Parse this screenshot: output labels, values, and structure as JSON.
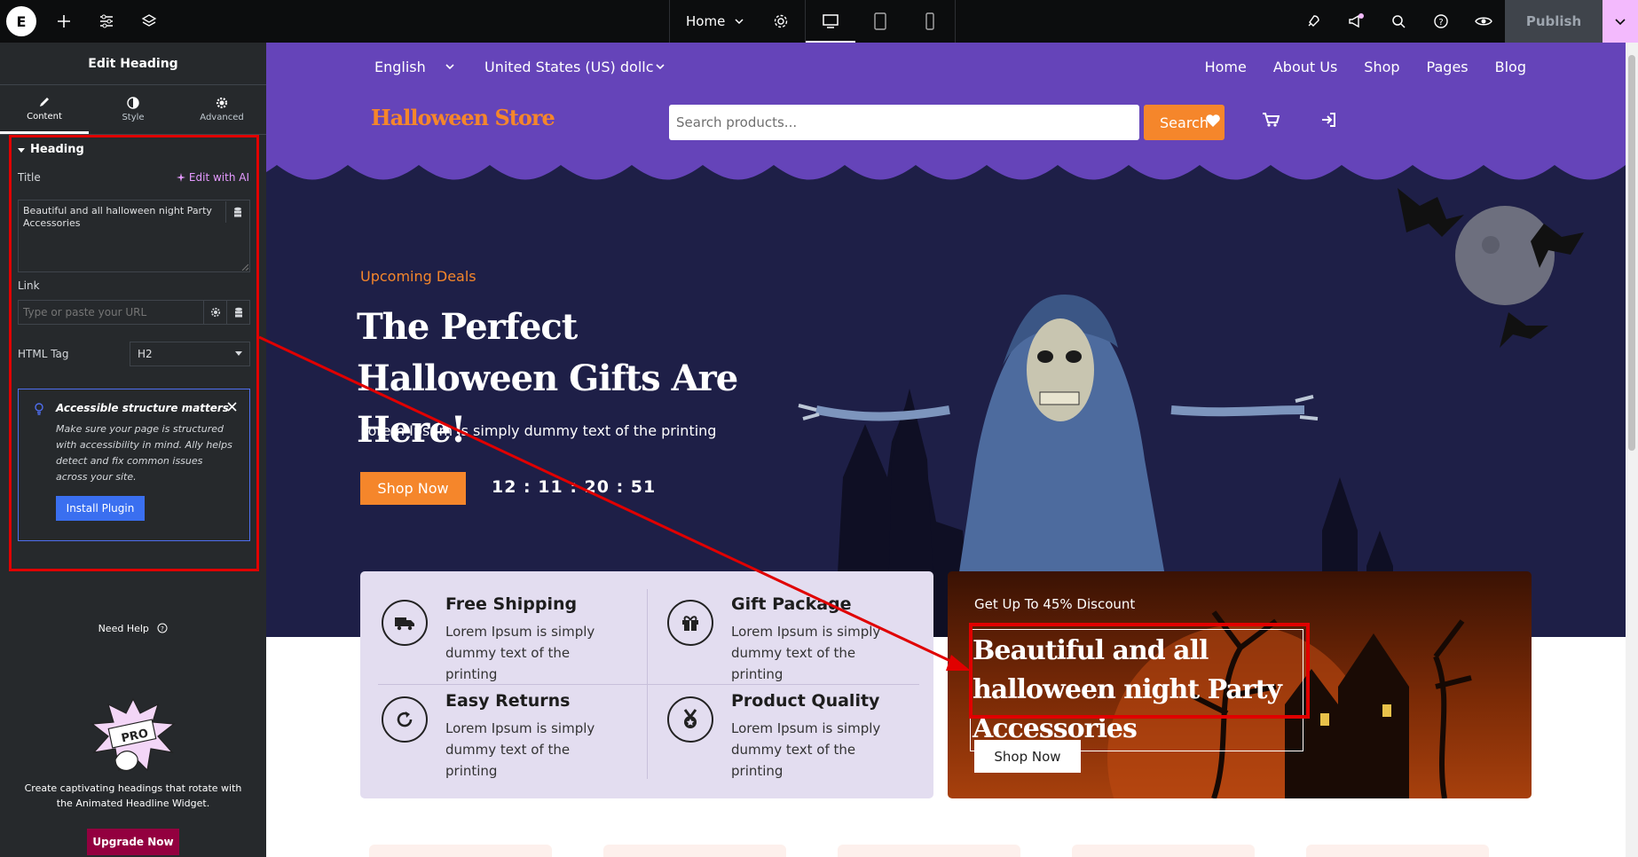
{
  "topbar": {
    "logo_letter": "E",
    "page_name": "Home",
    "publish_label": "Publish"
  },
  "panel": {
    "title": "Edit Heading",
    "tabs": [
      {
        "label": "Content",
        "icon": "pencil-icon"
      },
      {
        "label": "Style",
        "icon": "half-circle-icon"
      },
      {
        "label": "Advanced",
        "icon": "gear-icon"
      }
    ],
    "section_title": "Heading",
    "title_label": "Title",
    "ai_link": "Edit with AI",
    "title_value": "Beautiful and all halloween night Party Accessories",
    "link_label": "Link",
    "link_placeholder": "Type or paste your URL",
    "html_tag_label": "HTML Tag",
    "html_tag_value": "H2",
    "notice": {
      "title": "Accessible structure matters",
      "text": "Make sure your page is structured with accessibility in mind. Ally helps detect and fix common issues across your site.",
      "button": "Install Plugin"
    },
    "need_help": "Need Help",
    "promo_badge": "PRO",
    "promo_text": "Create captivating headings that rotate with the Animated Headline Widget.",
    "upgrade_label": "Upgrade Now"
  },
  "site": {
    "lang": "English",
    "currency": "United States (US) dollc",
    "nav": [
      "Home",
      "About Us",
      "Shop",
      "Pages",
      "Blog"
    ],
    "logo": "Halloween Store",
    "search_placeholder": "Search products...",
    "search_button": "Search",
    "hero": {
      "kicker": "Upcoming Deals",
      "title": "The Perfect Halloween Gifts Are Here!",
      "subtitle": "Lorem Ipsum is simply dummy text of the printing",
      "button": "Shop Now",
      "timer": "12 : 11 : 20 : 51"
    },
    "features": [
      {
        "title": "Free Shipping",
        "text": "Lorem Ipsum is simply dummy text of the printing",
        "icon": "truck-icon"
      },
      {
        "title": "Gift Package",
        "text": "Lorem Ipsum is simply dummy text of the printing",
        "icon": "gift-icon"
      },
      {
        "title": "Easy Returns",
        "text": "Lorem Ipsum is simply dummy text of the printing",
        "icon": "refresh-icon"
      },
      {
        "title": "Product Quality",
        "text": "Lorem Ipsum is simply dummy text of the printing",
        "icon": "medal-icon"
      }
    ],
    "promo": {
      "kicker": "Get Up To 45% Discount",
      "title": "Beautiful and all halloween night Party Accessories",
      "button": "Shop Now"
    }
  },
  "colors": {
    "accent_orange": "#f5862b",
    "site_purple": "#6544b9",
    "hero_navy": "#1e1f47",
    "highlight_red": "#e00000",
    "ai_pink": "#e59aff"
  }
}
